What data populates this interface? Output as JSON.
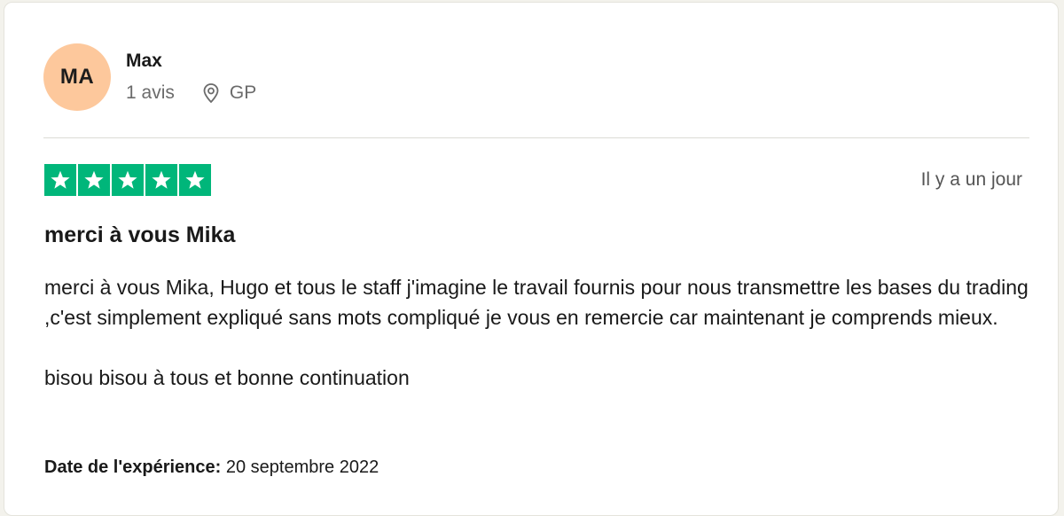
{
  "reviewer": {
    "initials": "MA",
    "name": "Max",
    "reviews_count": "1 avis",
    "location": "GP",
    "avatar_color": "#fdc89c"
  },
  "rating": {
    "stars": 5,
    "max_stars": 5,
    "star_color": "#00b67a"
  },
  "review": {
    "date": "Il y a un jour",
    "title": "merci à vous Mika",
    "paragraphs": [
      "merci à vous Mika, Hugo et tous le staff j'imagine le travail fournis pour nous transmettre les bases du trading ,c'est simplement expliqué sans mots compliqué je vous en remercie car maintenant je comprends mieux.",
      "bisou bisou à tous et bonne continuation"
    ],
    "experience_label": "Date de l'expérience:",
    "experience_date": "20 septembre 2022"
  },
  "icons": {
    "location": "map-pin-icon",
    "star": "star-icon"
  }
}
